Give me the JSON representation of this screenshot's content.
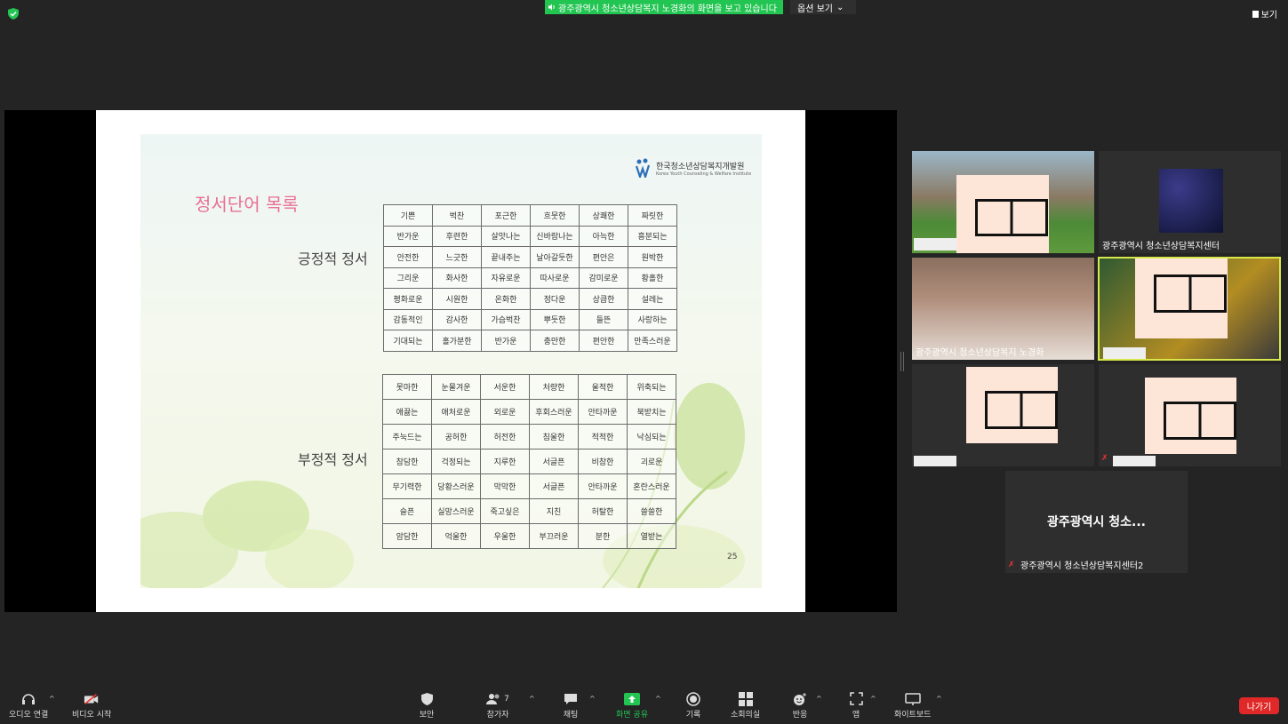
{
  "banner": {
    "message": "광주광역시 청소년상담복지 노경화의 화면을 보고 있습니다",
    "options": "옵션 보기"
  },
  "view_button": "보기",
  "slide": {
    "logo_ko": "한국청소년상담복지개발원",
    "logo_en": "Korea Youth Counseling & Welfare Institute",
    "title": "정서단어 목록",
    "positive_label": "긍정적 정서",
    "negative_label": "부정적 정서",
    "page_number": "25",
    "positive_rows": [
      [
        "기쁜",
        "벅찬",
        "포근한",
        "흐뭇한",
        "상쾌한",
        "짜릿한"
      ],
      [
        "반가운",
        "후련한",
        "살맛나는",
        "신바람나는",
        "아늑한",
        "흥분되는"
      ],
      [
        "안전한",
        "느긋한",
        "끝내주는",
        "날아갈듯한",
        "편안은",
        "원박한"
      ],
      [
        "그리운",
        "화사한",
        "자유로운",
        "따사로운",
        "감미로운",
        "황홀한"
      ],
      [
        "평화로운",
        "시원한",
        "온화한",
        "정다운",
        "상큼한",
        "설레는"
      ],
      [
        "감동적인",
        "감사한",
        "가슴벅찬",
        "뿌듯한",
        "들뜬",
        "사랑하는"
      ],
      [
        "기대되는",
        "홀가분한",
        "반가운",
        "충만한",
        "편안한",
        "만족스러운"
      ]
    ],
    "negative_rows": [
      [
        "못마한",
        "눈물겨운",
        "서운한",
        "처량한",
        "울적한",
        "위축되는"
      ],
      [
        "애끓는",
        "애처로운",
        "외로운",
        "후회스러운",
        "안타까운",
        "북받치는"
      ],
      [
        "주눅드는",
        "공허한",
        "허전한",
        "침울한",
        "적적한",
        "낙심되는"
      ],
      [
        "참담한",
        "걱정되는",
        "지루한",
        "서글픈",
        "비참한",
        "괴로운"
      ],
      [
        "무기력한",
        "당황스러운",
        "막막한",
        "서글픈",
        "안타까운",
        "혼란스러운"
      ],
      [
        "슬픈",
        "실망스러운",
        "죽고싶은",
        "지친",
        "허탈한",
        "쓸쓸한"
      ],
      [
        "암담한",
        "억울한",
        "우울한",
        "부끄러운",
        "분한",
        "열받는"
      ]
    ]
  },
  "participants": {
    "tile2_name": "광주광역시 청소년상담복지센터",
    "tile3_name": "광주광역시 청소년상담복지 노경화",
    "tile7_title": "광주광역시 청소...",
    "tile7_name": "광주광역시 청소년상담복지센터2"
  },
  "toolbar": {
    "audio": "오디오 연결",
    "video": "비디오 시작",
    "security": "보안",
    "participants": "참가자",
    "participant_count": "7",
    "chat": "채팅",
    "share": "화면 공유",
    "record": "기록",
    "breakout": "소회의실",
    "reactions": "반응",
    "apps": "앱",
    "whiteboard": "화이트보드",
    "leave": "나가기"
  },
  "colors": {
    "share_green": "#23c552",
    "leave_red": "#e02828",
    "active_border": "#d8e84a",
    "title_pink": "#ea6f97"
  }
}
